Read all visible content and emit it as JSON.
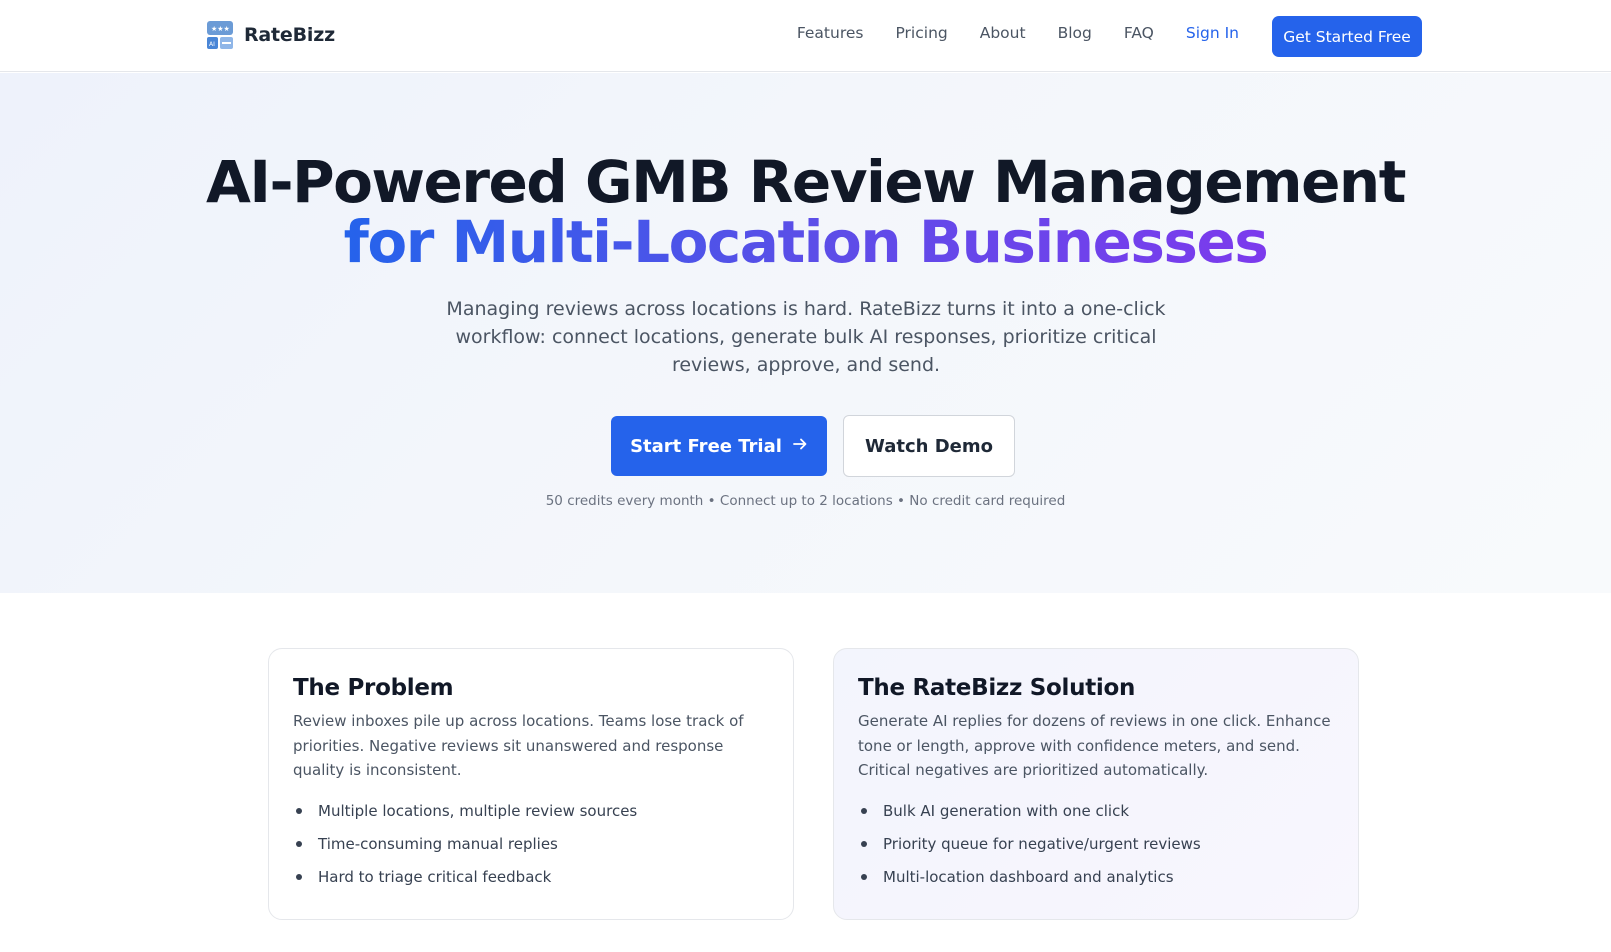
{
  "brand": {
    "name": "RateBizz",
    "icon": "reviews-ai-logo-icon"
  },
  "nav": {
    "links": [
      "Features",
      "Pricing",
      "About",
      "Blog",
      "FAQ"
    ],
    "signin": "Sign In",
    "cta": "Get Started Free"
  },
  "hero": {
    "title_line1": "AI-Powered GMB Review Management",
    "title_line2": "for Multi-Location Businesses",
    "lead": "Managing reviews across locations is hard. RateBizz turns it into a one-click workflow: connect locations, generate bulk AI responses, prioritize critical reviews, approve, and send.",
    "primary_cta": "Start Free Trial",
    "primary_icon": "arrow-right-icon",
    "secondary_cta": "Watch Demo",
    "fine_print": "50 credits every month • Connect up to 2 locations • No credit card required"
  },
  "problem": {
    "title": "The Problem",
    "body": "Review inboxes pile up across locations. Teams lose track of priorities. Negative reviews sit unanswered and response quality is inconsistent.",
    "items": [
      "Multiple locations, multiple review sources",
      "Time-consuming manual replies",
      "Hard to triage critical feedback"
    ]
  },
  "solution": {
    "title": "The RateBizz Solution",
    "body": "Generate AI replies for dozens of reviews in one click. Enhance tone or length, approve with confidence meters, and send. Critical negatives are prioritized automatically.",
    "items": [
      "Bulk AI generation with one click",
      "Priority queue for negative/urgent reviews",
      "Multi-location dashboard and analytics"
    ]
  },
  "colors": {
    "accent": "#2563eb",
    "gradient_end": "#7c3aed"
  }
}
